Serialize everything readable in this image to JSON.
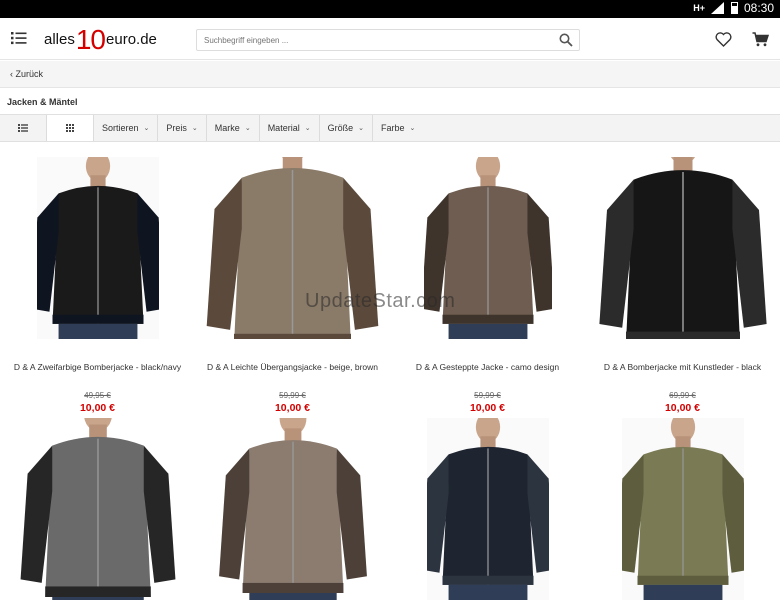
{
  "statusbar": {
    "network": "H+",
    "time": "08:30"
  },
  "header": {
    "logo_prefix": "alles",
    "logo_number": "10",
    "logo_suffix": "euro.de",
    "search_placeholder": "Suchbegriff eingeben ..."
  },
  "nav": {
    "back_label": "Zurück"
  },
  "category": {
    "title": "Jacken & Mäntel"
  },
  "filters": [
    "Sortieren",
    "Preis",
    "Marke",
    "Material",
    "Größe",
    "Farbe"
  ],
  "watermark": "UpdateStar.com",
  "products": [
    {
      "name": "D & A Zweifarbige Bomberjacke - black/navy",
      "old_price": "49,95 €",
      "price": "10,00 €",
      "colors": [
        "#1a1a1a",
        "#0f1520"
      ]
    },
    {
      "name": "D & A Leichte Übergangsjacke - beige, brown",
      "old_price": "59,99 €",
      "price": "10,00 €",
      "colors": [
        "#8a7a68",
        "#5b4a3c"
      ]
    },
    {
      "name": "D & A Gesteppte Jacke - camo design",
      "old_price": "59,99 €",
      "price": "10,00 €",
      "colors": [
        "#6e5d50",
        "#3f342c"
      ]
    },
    {
      "name": "D & A Bomberjacke mit Kunstleder - black",
      "old_price": "69,99 €",
      "price": "10,00 €",
      "colors": [
        "#161616",
        "#2b2b2b"
      ]
    },
    {
      "name": "",
      "old_price": "",
      "price": "",
      "colors": [
        "#6a6a6a",
        "#262626"
      ]
    },
    {
      "name": "",
      "old_price": "",
      "price": "",
      "colors": [
        "#8c7c70",
        "#4d4038"
      ]
    },
    {
      "name": "",
      "old_price": "",
      "price": "",
      "colors": [
        "#1f2530",
        "#2c3440"
      ]
    },
    {
      "name": "",
      "old_price": "",
      "price": "",
      "colors": [
        "#7a7a55",
        "#5e5e3e"
      ]
    }
  ]
}
